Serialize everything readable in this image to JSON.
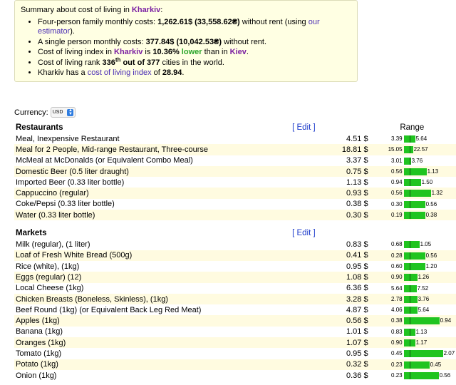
{
  "summary": {
    "title_prefix": "Summary about cost of living in ",
    "city": "Kharkiv",
    "title_suffix": ":",
    "family_prefix": "Four-person family monthly costs: ",
    "family_value": "1,262.61$ (33,558.62₴)",
    "family_mid": " without rent (using ",
    "family_link": "our estimator",
    "family_end": ").",
    "single_prefix": "A single person monthly costs: ",
    "single_value": "377.84$ (10,042.53₴)",
    "single_suffix": " without rent.",
    "index_prefix": "Cost of living index in ",
    "index_city": "Kharkiv",
    "index_is": " is ",
    "index_value": "10.36%",
    "index_lower": "lower",
    "index_than": " than in ",
    "index_other_city": "Kiev",
    "index_end": ".",
    "rank_prefix": "Cost of living rank ",
    "rank_value": "336",
    "rank_sup": "th",
    "rank_of": " out of 377",
    "rank_suffix": " cities in the world.",
    "col_prefix": "Kharkiv has a ",
    "col_link": "cost of living index",
    "col_of": " of ",
    "col_value": "28.94",
    "col_end": "."
  },
  "currency": {
    "label": "Currency:",
    "value": "USD"
  },
  "sections": [
    {
      "title": "Restaurants",
      "edit": "[ Edit ]",
      "range_header": "Range",
      "rows": [
        {
          "name": "Meal, Inexpensive Restaurant",
          "price": "4.51 $",
          "lo": "3.39",
          "hi": "5.64",
          "w": 0.2
        },
        {
          "name": "Meal for 2 People, Mid-range Restaurant, Three-course",
          "price": "18.81 $",
          "lo": "15.05",
          "hi": "22.57",
          "w": 0.16
        },
        {
          "name": "McMeal at McDonalds (or Equivalent Combo Meal)",
          "price": "3.37 $",
          "lo": "3.01",
          "hi": "3.76",
          "w": 0.12
        },
        {
          "name": "Domestic Beer (0.5 liter draught)",
          "price": "0.75 $",
          "lo": "0.56",
          "hi": "1.13",
          "w": 0.4
        },
        {
          "name": "Imported Beer (0.33 liter bottle)",
          "price": "1.13 $",
          "lo": "0.94",
          "hi": "1.50",
          "w": 0.3
        },
        {
          "name": "Cappuccino (regular)",
          "price": "0.93 $",
          "lo": "0.56",
          "hi": "1.32",
          "w": 0.47
        },
        {
          "name": "Coke/Pepsi (0.33 liter bottle)",
          "price": "0.38 $",
          "lo": "0.30",
          "hi": "0.56",
          "w": 0.37
        },
        {
          "name": "Water (0.33 liter bottle)",
          "price": "0.30 $",
          "lo": "0.19",
          "hi": "0.38",
          "w": 0.37
        }
      ]
    },
    {
      "title": "Markets",
      "edit": "[ Edit ]",
      "range_header": "",
      "rows": [
        {
          "name": "Milk (regular), (1 liter)",
          "price": "0.83 $",
          "lo": "0.68",
          "hi": "1.05",
          "w": 0.27
        },
        {
          "name": "Loaf of Fresh White Bread (500g)",
          "price": "0.41 $",
          "lo": "0.28",
          "hi": "0.56",
          "w": 0.37
        },
        {
          "name": "Rice (white), (1kg)",
          "price": "0.95 $",
          "lo": "0.60",
          "hi": "1.20",
          "w": 0.37
        },
        {
          "name": "Eggs (regular) (12)",
          "price": "1.08 $",
          "lo": "0.90",
          "hi": "1.26",
          "w": 0.24
        },
        {
          "name": "Local Cheese (1kg)",
          "price": "6.36 $",
          "lo": "5.64",
          "hi": "7.52",
          "w": 0.22
        },
        {
          "name": "Chicken Breasts (Boneless, Skinless), (1kg)",
          "price": "3.28 $",
          "lo": "2.78",
          "hi": "3.76",
          "w": 0.24
        },
        {
          "name": "Beef Round (1kg) (or Equivalent Back Leg Red Meat)",
          "price": "4.87 $",
          "lo": "4.06",
          "hi": "5.64",
          "w": 0.24
        },
        {
          "name": "Apples (1kg)",
          "price": "0.56 $",
          "lo": "0.38",
          "hi": "0.94",
          "w": 0.63
        },
        {
          "name": "Banana (1kg)",
          "price": "1.01 $",
          "lo": "0.83",
          "hi": "1.13",
          "w": 0.2
        },
        {
          "name": "Oranges (1kg)",
          "price": "1.07 $",
          "lo": "0.90",
          "hi": "1.17",
          "w": 0.2
        },
        {
          "name": "Tomato (1kg)",
          "price": "0.95 $",
          "lo": "0.45",
          "hi": "2.07",
          "w": 0.69
        },
        {
          "name": "Potato (1kg)",
          "price": "0.32 $",
          "lo": "0.23",
          "hi": "0.45",
          "w": 0.45
        },
        {
          "name": "Onion (1kg)",
          "price": "0.36 $",
          "lo": "0.23",
          "hi": "0.56",
          "w": 0.61
        }
      ]
    }
  ]
}
